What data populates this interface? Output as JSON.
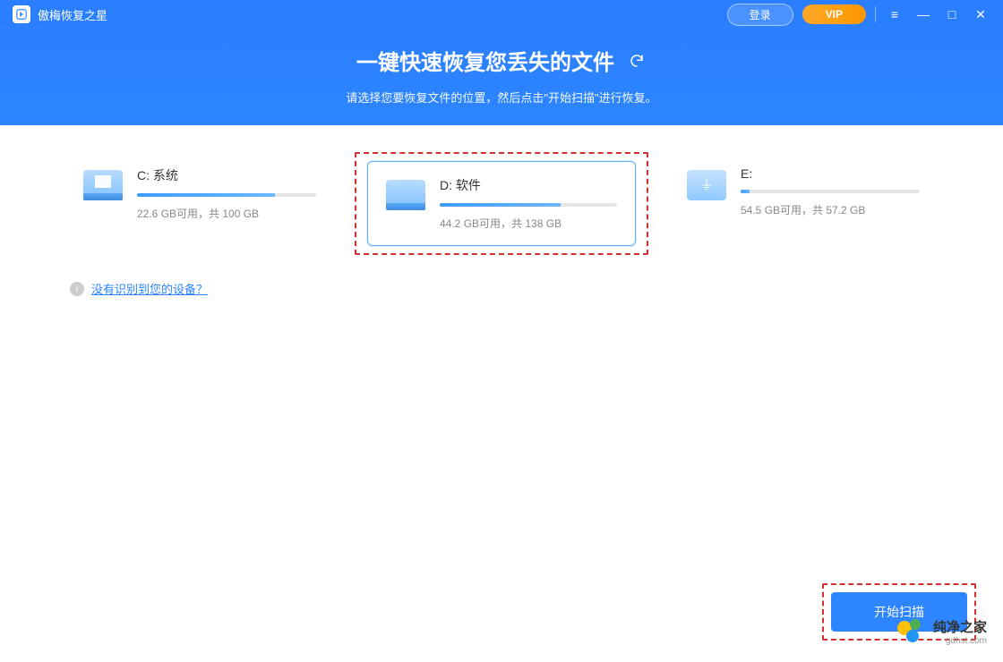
{
  "app": {
    "name": "傲梅恢复之星"
  },
  "titlebar": {
    "login": "登录",
    "vip": "VIP"
  },
  "hero": {
    "title": "一键快速恢复您丢失的文件",
    "subtitle": "请选择您要恢复文件的位置，然后点击\"开始扫描\"进行恢复。"
  },
  "drives": [
    {
      "name": "C: 系统",
      "stats": "22.6 GB可用，共 100 GB",
      "fill": 77,
      "icon": "win"
    },
    {
      "name": "D: 软件",
      "stats": "44.2 GB可用，共 138 GB",
      "fill": 68,
      "icon": "hdd",
      "selected": true
    },
    {
      "name": "E:",
      "stats": "54.5 GB可用，共 57.2 GB",
      "fill": 5,
      "icon": "usb"
    }
  ],
  "help": {
    "label": "没有识别到您的设备？"
  },
  "footer": {
    "scan": "开始扫描"
  },
  "watermark": {
    "name": "纯净之家",
    "site": "gdhst.com"
  }
}
